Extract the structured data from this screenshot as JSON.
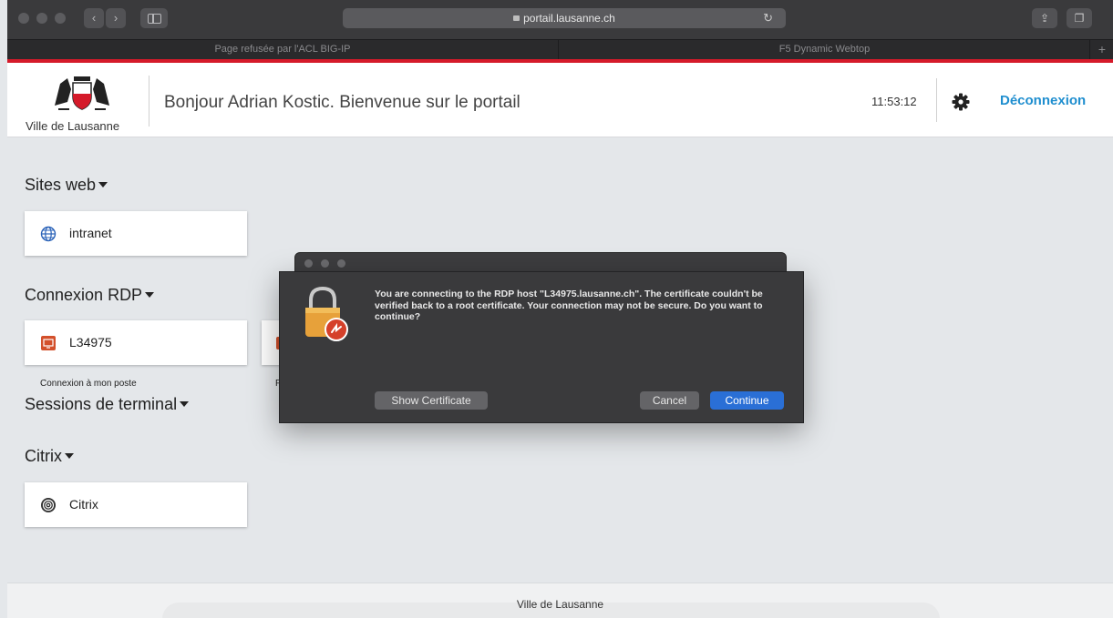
{
  "browser": {
    "url": "portail.lausanne.ch",
    "tabs": [
      {
        "label": "Page refusée par l'ACL BIG-IP"
      },
      {
        "label": "F5 Dynamic Webtop"
      }
    ],
    "new_tab_label": "+"
  },
  "header": {
    "logo_text": "Ville de Lausanne",
    "greeting": "Bonjour Adrian Kostic. Bienvenue sur le portail",
    "clock": "11:53:12",
    "logout_label": "Déconnexion",
    "accent_color": "#1f8ecf",
    "brand_red": "#d51a2a"
  },
  "sections": {
    "sites_web": {
      "title": "Sites web",
      "items": [
        {
          "label": "intranet",
          "icon": "globe-icon"
        }
      ]
    },
    "rdp": {
      "title": "Connexion RDP",
      "items": [
        {
          "label": "L34975",
          "icon": "rdp-icon",
          "caption": "Connexion à mon poste"
        }
      ]
    },
    "terminal": {
      "title": "Sessions de terminal"
    },
    "citrix": {
      "title": "Citrix",
      "items": [
        {
          "label": "Citrix",
          "icon": "citrix-icon"
        }
      ]
    }
  },
  "partial_card": {
    "caption": "F"
  },
  "dialog": {
    "message": "You are connecting to the RDP host \"L34975.lausanne.ch\". The certificate couldn't be verified back to a root certificate. Your connection may not be secure. Do you want to continue?",
    "show_certificate_label": "Show Certificate",
    "cancel_label": "Cancel",
    "continue_label": "Continue"
  },
  "footer": {
    "text": "Ville de Lausanne"
  }
}
